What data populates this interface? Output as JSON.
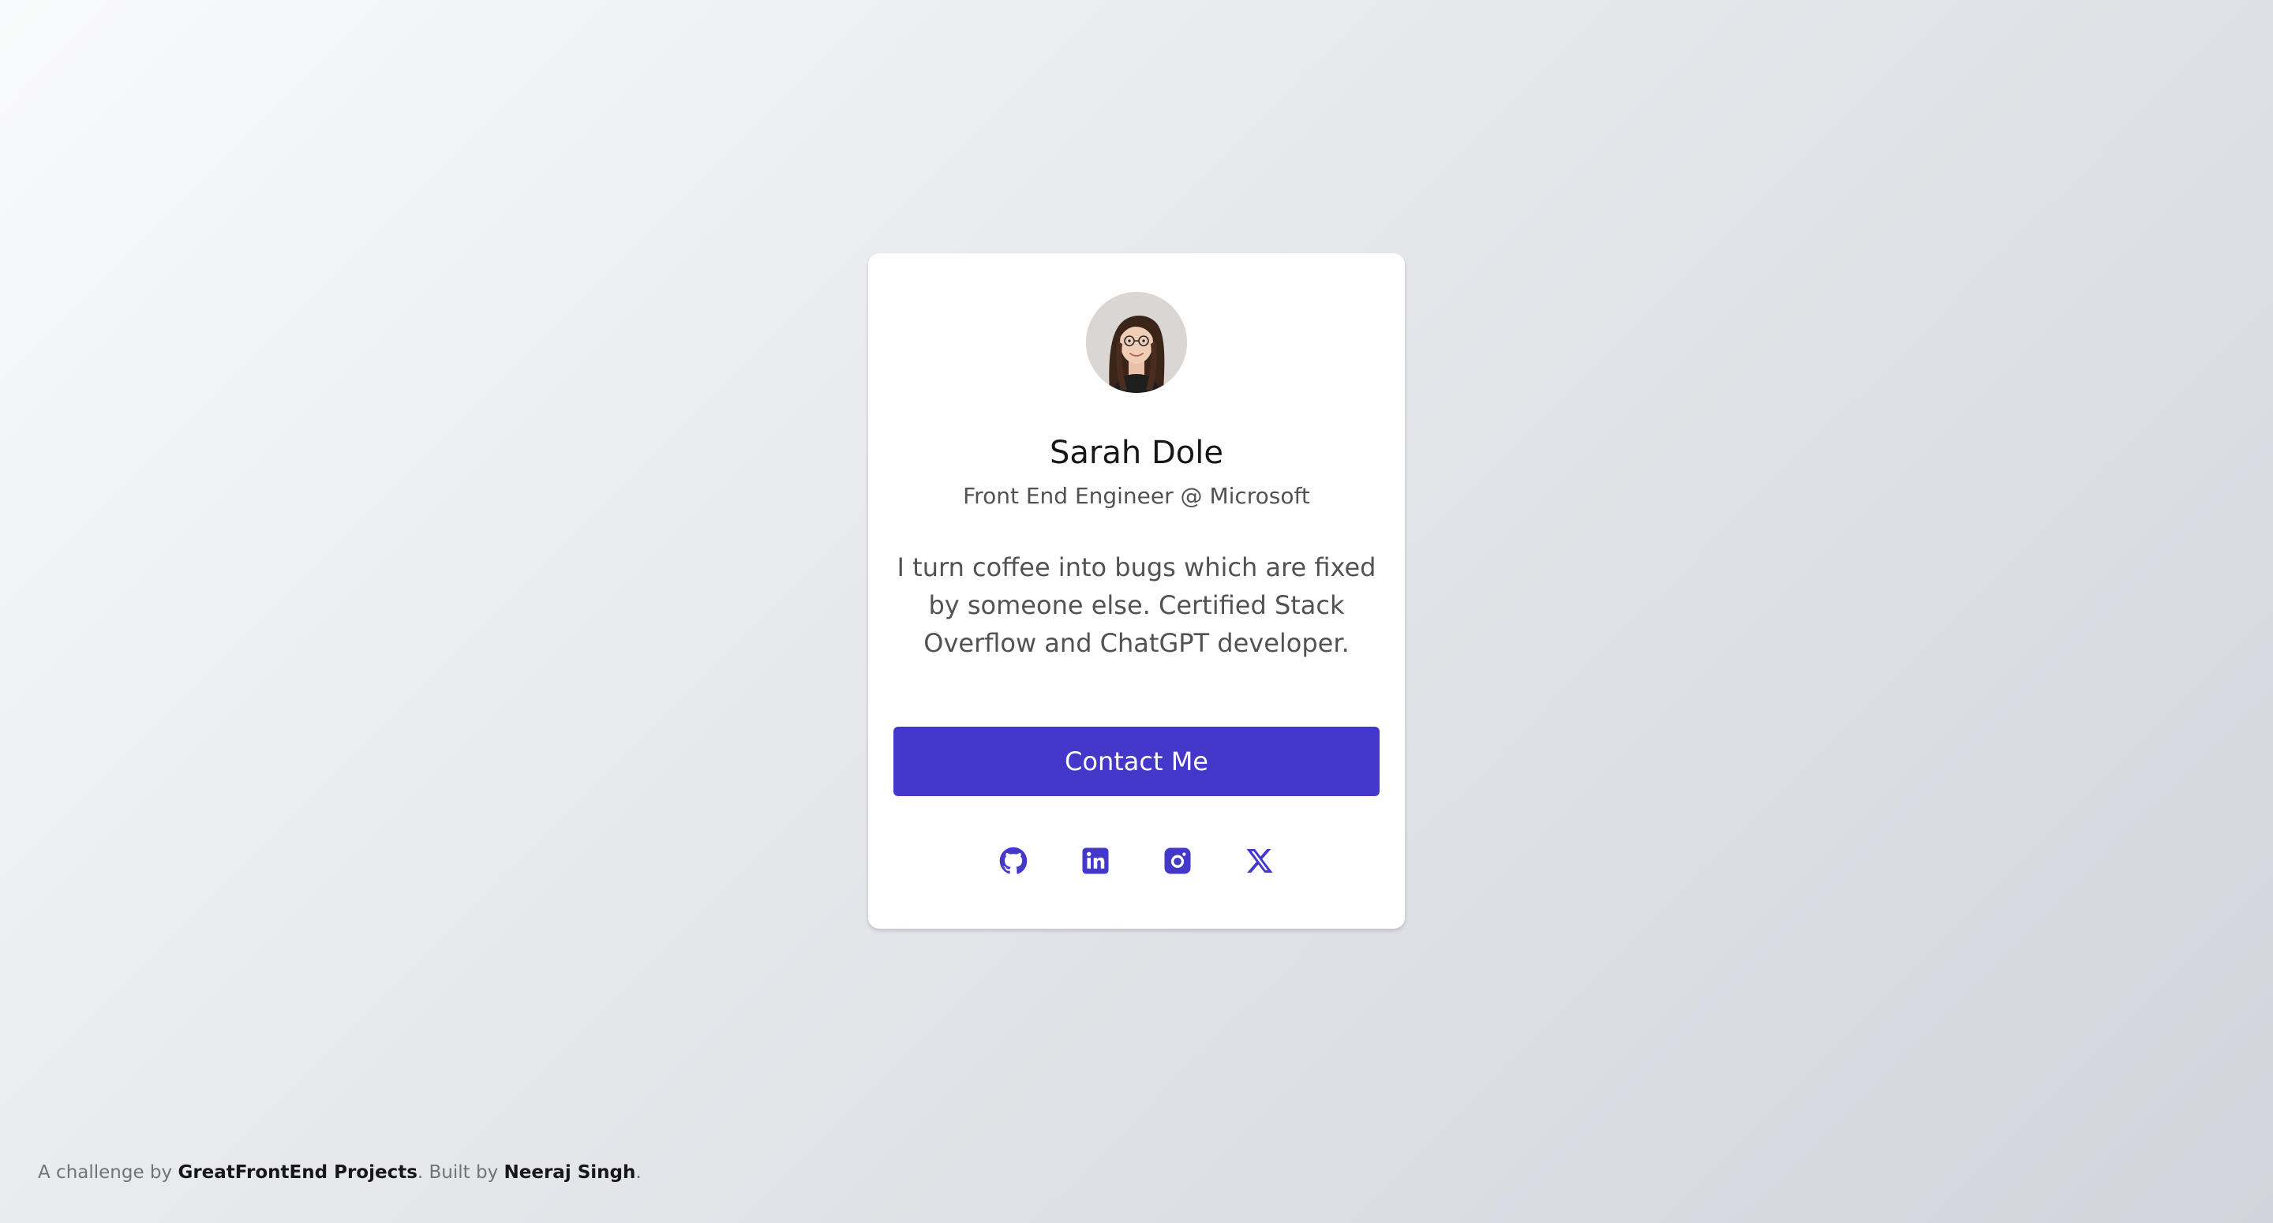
{
  "profile": {
    "name": "Sarah Dole",
    "role": "Front End Engineer @ Microsoft",
    "bio": "I turn coffee into bugs which are fixed by someone else. Certified Stack Overflow and ChatGPT developer.",
    "contact_label": "Contact Me",
    "avatar_icon": "avatar-photo"
  },
  "socials": [
    {
      "icon": "github-icon"
    },
    {
      "icon": "linkedin-icon"
    },
    {
      "icon": "instagram-icon"
    },
    {
      "icon": "x-icon"
    }
  ],
  "footer": {
    "prefix": "A challenge by ",
    "challenge_link": "GreatFrontEnd Projects",
    "middle": ". Built by ",
    "author_link": "Neeraj Singh",
    "suffix": "."
  },
  "colors": {
    "accent": "#4338ca",
    "card_bg": "#ffffff",
    "text_primary": "#171717",
    "text_secondary": "#525252"
  }
}
